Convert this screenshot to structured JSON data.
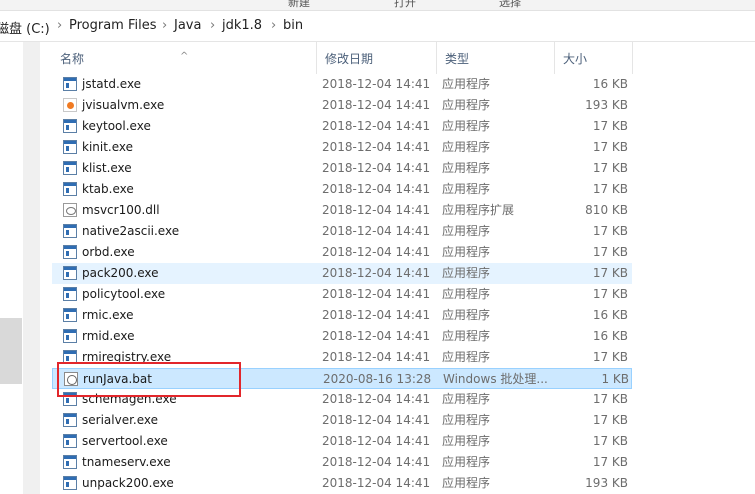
{
  "toolbar": {
    "open_label": "打开",
    "new_label": "新建",
    "select_label": "选择"
  },
  "address": {
    "drive": "磁盘 (C:)",
    "p1": "Program Files",
    "p2": "Java",
    "p3": "jdk1.8",
    "p4": "bin",
    "sep": "›"
  },
  "columns": {
    "name": "名称",
    "date": "修改日期",
    "type": "类型",
    "size": "大小",
    "sort_glyph": "^"
  },
  "files": [
    {
      "name": "jstatd.exe",
      "date": "2018-12-04 14:41",
      "type": "应用程序",
      "size": "16 KB",
      "icon": "exe"
    },
    {
      "name": "jvisualvm.exe",
      "date": "2018-12-04 14:41",
      "type": "应用程序",
      "size": "193 KB",
      "icon": "jvm"
    },
    {
      "name": "keytool.exe",
      "date": "2018-12-04 14:41",
      "type": "应用程序",
      "size": "17 KB",
      "icon": "exe"
    },
    {
      "name": "kinit.exe",
      "date": "2018-12-04 14:41",
      "type": "应用程序",
      "size": "17 KB",
      "icon": "exe"
    },
    {
      "name": "klist.exe",
      "date": "2018-12-04 14:41",
      "type": "应用程序",
      "size": "17 KB",
      "icon": "exe"
    },
    {
      "name": "ktab.exe",
      "date": "2018-12-04 14:41",
      "type": "应用程序",
      "size": "17 KB",
      "icon": "exe"
    },
    {
      "name": "msvcr100.dll",
      "date": "2018-12-04 14:41",
      "type": "应用程序扩展",
      "size": "810 KB",
      "icon": "dll"
    },
    {
      "name": "native2ascii.exe",
      "date": "2018-12-04 14:41",
      "type": "应用程序",
      "size": "17 KB",
      "icon": "exe"
    },
    {
      "name": "orbd.exe",
      "date": "2018-12-04 14:41",
      "type": "应用程序",
      "size": "17 KB",
      "icon": "exe"
    },
    {
      "name": "pack200.exe",
      "date": "2018-12-04 14:41",
      "type": "应用程序",
      "size": "17 KB",
      "icon": "exe"
    },
    {
      "name": "policytool.exe",
      "date": "2018-12-04 14:41",
      "type": "应用程序",
      "size": "17 KB",
      "icon": "exe"
    },
    {
      "name": "rmic.exe",
      "date": "2018-12-04 14:41",
      "type": "应用程序",
      "size": "16 KB",
      "icon": "exe"
    },
    {
      "name": "rmid.exe",
      "date": "2018-12-04 14:41",
      "type": "应用程序",
      "size": "16 KB",
      "icon": "exe"
    },
    {
      "name": "rmiregistry.exe",
      "date": "2018-12-04 14:41",
      "type": "应用程序",
      "size": "17 KB",
      "icon": "exe"
    },
    {
      "name": "runJava.bat",
      "date": "2020-08-16 13:28",
      "type": "Windows 批处理...",
      "size": "1 KB",
      "icon": "bat"
    },
    {
      "name": "schemagen.exe",
      "date": "2018-12-04 14:41",
      "type": "应用程序",
      "size": "17 KB",
      "icon": "exe"
    },
    {
      "name": "serialver.exe",
      "date": "2018-12-04 14:41",
      "type": "应用程序",
      "size": "17 KB",
      "icon": "exe"
    },
    {
      "name": "servertool.exe",
      "date": "2018-12-04 14:41",
      "type": "应用程序",
      "size": "17 KB",
      "icon": "exe"
    },
    {
      "name": "tnameserv.exe",
      "date": "2018-12-04 14:41",
      "type": "应用程序",
      "size": "17 KB",
      "icon": "exe"
    },
    {
      "name": "unpack200.exe",
      "date": "2018-12-04 14:41",
      "type": "应用程序",
      "size": "193 KB",
      "icon": "exe"
    }
  ],
  "state": {
    "hover_index": 9,
    "selected_index": 14
  },
  "colors": {
    "highlight": "#e2262b",
    "selected_bg": "#cce8ff",
    "hover_bg": "#e5f3ff"
  }
}
